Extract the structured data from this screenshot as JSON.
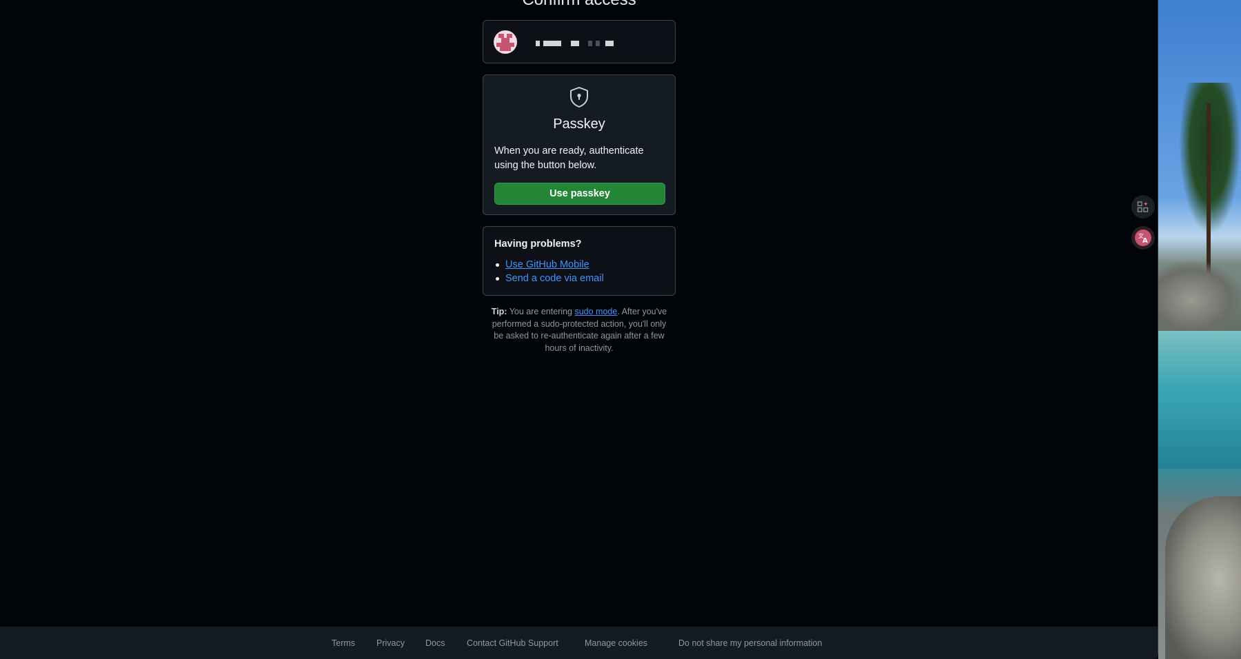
{
  "page": {
    "title": "Confirm access"
  },
  "account": {
    "avatar_icon": "identicon-avatar"
  },
  "passkey": {
    "icon": "shield-keyhole-icon",
    "title": "Passkey",
    "description": "When you are ready, authenticate using the button below.",
    "button_label": "Use passkey"
  },
  "problems": {
    "title": "Having problems?",
    "links": [
      "Use GitHub Mobile",
      "Send a code via email"
    ]
  },
  "tip": {
    "label": "Tip:",
    "before_link": " You are entering ",
    "link_text": "sudo mode",
    "after_link": ". After you've performed a sudo-protected action, you'll only be asked to re-authenticate again after a few hours of inactivity."
  },
  "footer": {
    "links": [
      "Terms",
      "Privacy",
      "Docs",
      "Contact GitHub Support",
      "Manage cookies",
      "Do not share my personal information"
    ]
  },
  "side_buttons": {
    "apps_icon": "apps-sparkle-icon",
    "translate_icon": "translate-icon"
  },
  "colors": {
    "background": "#010409",
    "card": "#151b23",
    "border": "#3d444d",
    "primary_button": "#238636",
    "link": "#4493f8",
    "muted_text": "#9198a1"
  }
}
